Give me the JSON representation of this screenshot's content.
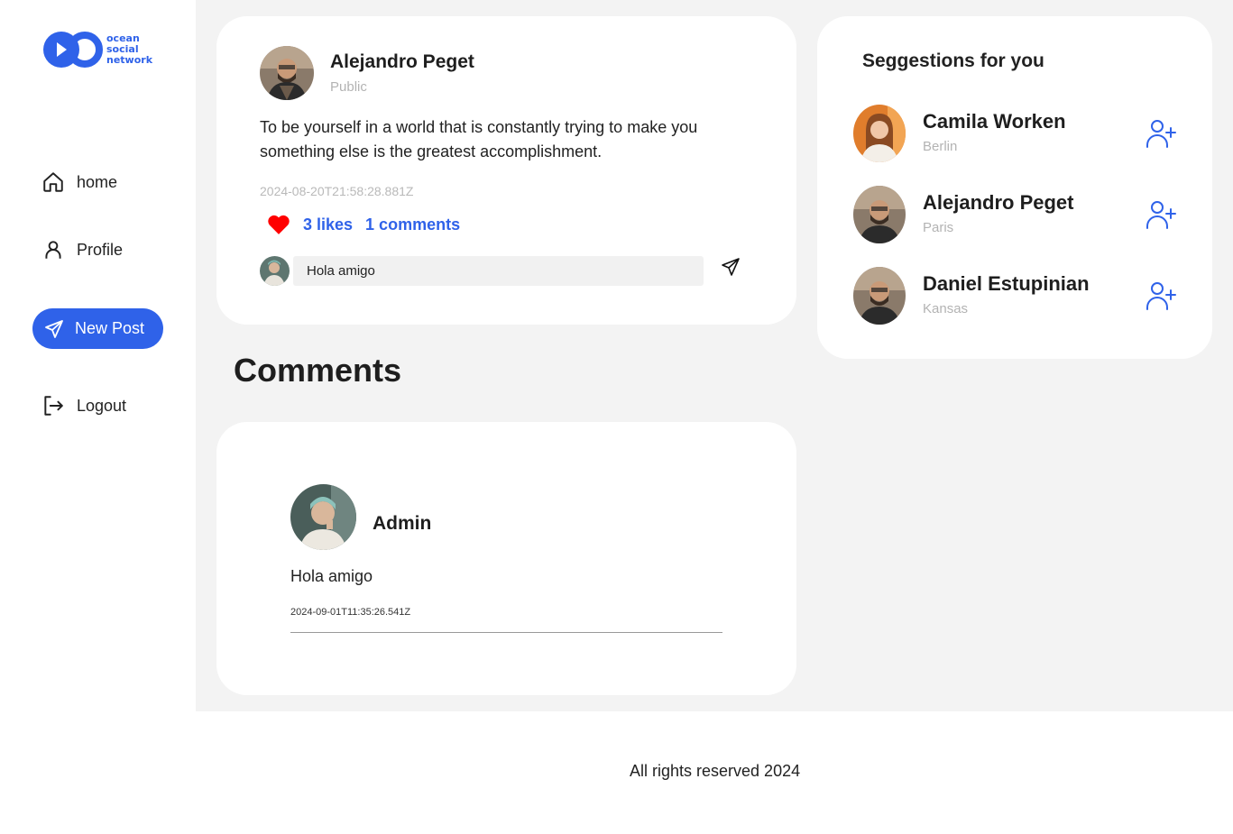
{
  "brand": {
    "line1": "ocean",
    "line2": "social",
    "line3": "network",
    "color": "#2f62e9"
  },
  "nav": {
    "home": "home",
    "profile": "Profile",
    "new_post": "New Post",
    "logout": "Logout"
  },
  "post": {
    "author": "Alejandro Peget",
    "visibility": "Public",
    "body": "To be yourself in a world that is constantly trying to make you something else is the greatest accomplishment.",
    "date": "2024-08-20T21:58:28.881Z",
    "likes": "3 likes",
    "comments": "1 comments",
    "comment_input_value": "Hola amigo"
  },
  "comments_section": {
    "title": "Comments",
    "items": [
      {
        "author": "Admin",
        "text": "Hola amigo",
        "date": "2024-09-01T11:35:26.541Z"
      }
    ]
  },
  "suggestions": {
    "title": "Seggestions for you",
    "items": [
      {
        "name": "Camila Worken",
        "city": "Berlin"
      },
      {
        "name": "Alejandro Peget",
        "city": "Paris"
      },
      {
        "name": "Daniel Estupinian",
        "city": "Kansas"
      }
    ]
  },
  "footer": {
    "text": "All rights reserved 2024"
  },
  "colors": {
    "accent": "#2f62e9",
    "like": "#ff0000",
    "background": "#f3f3f3"
  }
}
